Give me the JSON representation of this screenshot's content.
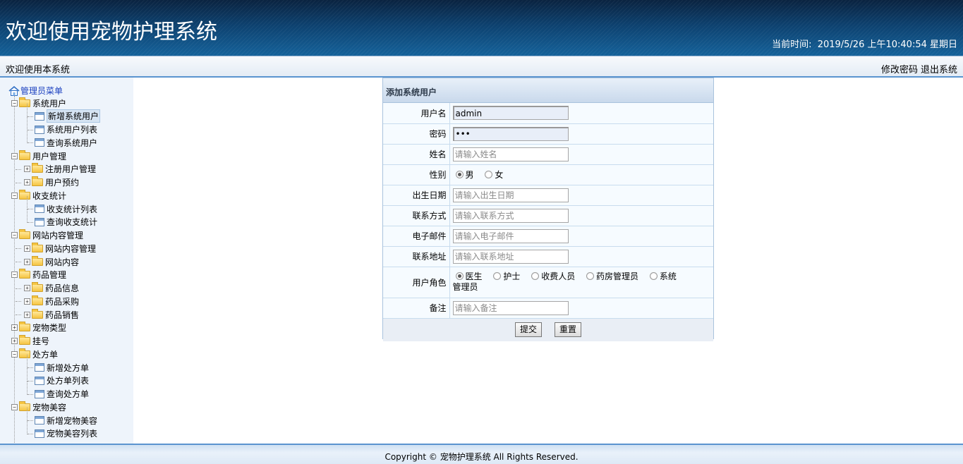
{
  "header": {
    "title": "欢迎使用宠物护理系统",
    "clock_label": "当前时间:",
    "clock_value": "2019/5/26 上午10:40:54 星期日"
  },
  "subbar": {
    "welcome": "欢迎使用本系统",
    "change_password": "修改密码",
    "logout": "退出系统"
  },
  "sidebar": {
    "root": "管理员菜单",
    "items": [
      {
        "label": "系统用户",
        "type": "folder",
        "expanded": true
      },
      {
        "label": "新增系统用户",
        "type": "leaf",
        "selected": true
      },
      {
        "label": "系统用户列表",
        "type": "leaf"
      },
      {
        "label": "查询系统用户",
        "type": "leaf"
      },
      {
        "label": "用户管理",
        "type": "folder",
        "expanded": true
      },
      {
        "label": "注册用户管理",
        "type": "subfolder"
      },
      {
        "label": "用户预约",
        "type": "subfolder"
      },
      {
        "label": "收支统计",
        "type": "folder",
        "expanded": true
      },
      {
        "label": "收支统计列表",
        "type": "leaf"
      },
      {
        "label": "查询收支统计",
        "type": "leaf"
      },
      {
        "label": "网站内容管理",
        "type": "folder",
        "expanded": true
      },
      {
        "label": "网站内容管理",
        "type": "subfolder"
      },
      {
        "label": "网站内容",
        "type": "subfolder"
      },
      {
        "label": "药品管理",
        "type": "folder",
        "expanded": true
      },
      {
        "label": "药品信息",
        "type": "subfolder"
      },
      {
        "label": "药品采购",
        "type": "subfolder"
      },
      {
        "label": "药品销售",
        "type": "subfolder"
      },
      {
        "label": "宠物类型",
        "type": "folder",
        "expanded": false
      },
      {
        "label": "挂号",
        "type": "folder",
        "expanded": false
      },
      {
        "label": "处方单",
        "type": "folder",
        "expanded": true
      },
      {
        "label": "新增处方单",
        "type": "leaf"
      },
      {
        "label": "处方单列表",
        "type": "leaf"
      },
      {
        "label": "查询处方单",
        "type": "leaf"
      },
      {
        "label": "宠物美容",
        "type": "folder",
        "expanded": true
      },
      {
        "label": "新增宠物美容",
        "type": "leaf"
      },
      {
        "label": "宠物美容列表",
        "type": "leaf"
      }
    ]
  },
  "form": {
    "title": "添加系统用户",
    "username": {
      "label": "用户名",
      "value": "admin"
    },
    "password": {
      "label": "密码",
      "value": "•••"
    },
    "name": {
      "label": "姓名",
      "placeholder": "请输入姓名"
    },
    "gender": {
      "label": "性别",
      "options": [
        "男",
        "女"
      ],
      "selected": "男"
    },
    "birthdate": {
      "label": "出生日期",
      "placeholder": "请输入出生日期"
    },
    "contact": {
      "label": "联系方式",
      "placeholder": "请输入联系方式"
    },
    "email": {
      "label": "电子邮件",
      "placeholder": "请输入电子邮件"
    },
    "address": {
      "label": "联系地址",
      "placeholder": "请输入联系地址"
    },
    "role": {
      "label": "用户角色",
      "options": [
        "医生",
        "护士",
        "收费人员",
        "药房管理员",
        "系统"
      ],
      "wrap": "管理员",
      "selected": "医生"
    },
    "remark": {
      "label": "备注",
      "placeholder": "请输入备注"
    },
    "submit": "提交",
    "reset": "重置"
  },
  "footer": {
    "copyright": "Copyright © 宠物护理系统 All Rights Reserved."
  }
}
